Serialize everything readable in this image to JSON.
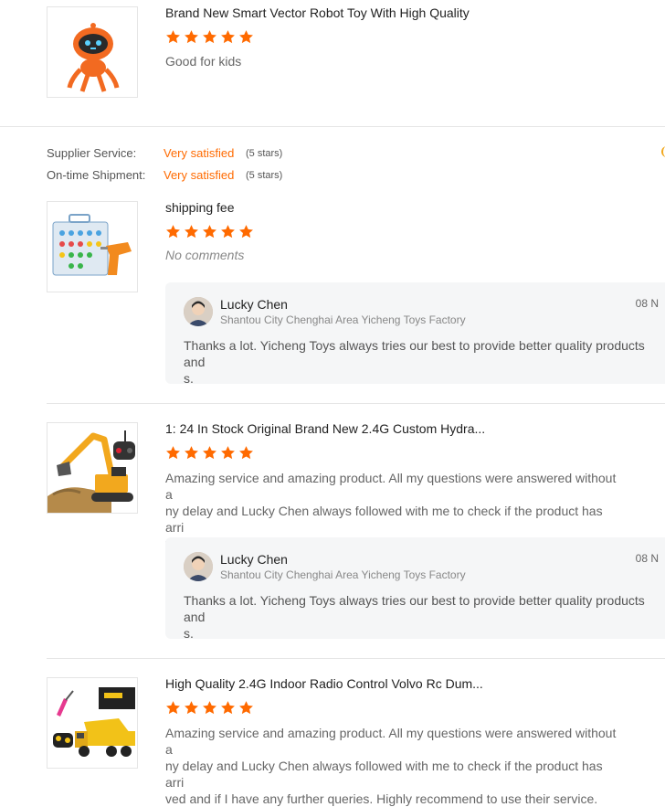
{
  "reviews": [
    {
      "product_title": "Brand New Smart Vector Robot Toy With High Quality",
      "rating": 5,
      "comment": "Good for kids",
      "image": "orange-robot-toy"
    },
    {
      "product_title": "shipping fee",
      "rating": 5,
      "comment": "No comments",
      "image": "toy-drill-set"
    },
    {
      "product_title": "1: 24 In Stock Original Brand New 2.4G Custom Hydra...",
      "rating": 5,
      "comment": "Amazing service and amazing product. All my questions were answered without a\nny delay and Lucky Chen always followed with me to check if the product has arri\nved and if I have any further queries. Highly recommend to use their service.",
      "image": "rc-excavator"
    },
    {
      "product_title": "High Quality 2.4G Indoor Radio Control Volvo Rc Dum...",
      "rating": 5,
      "comment": "Amazing service and amazing product. All my questions were answered without a\nny delay and Lucky Chen always followed with me to check if the product has arri\nved and if I have any further queries. Highly recommend to use their service.",
      "image": "rc-dump-truck"
    }
  ],
  "supplier_ratings": {
    "service_label": "Supplier Service:",
    "service_value": "Very satisfied",
    "service_count": "(5 stars)",
    "shipment_label": "On-time Shipment:",
    "shipment_value": "Very satisfied",
    "shipment_count": "(5 stars)"
  },
  "replies": [
    {
      "name": "Lucky Chen",
      "company": "Shantou City Chenghai Area Yicheng Toys Factory",
      "date": "08 N",
      "text": "Thanks a lot.  Yicheng Toys always tries our best to provide better quality products and\ns."
    },
    {
      "name": "Lucky Chen",
      "company": "Shantou City Chenghai Area Yicheng Toys Factory",
      "date": "08 N",
      "text": "Thanks a lot.  Yicheng Toys always tries our best to provide better quality products and\ns."
    }
  ],
  "colors": {
    "accent": "#ff6a00",
    "star": "#ff6a00"
  }
}
